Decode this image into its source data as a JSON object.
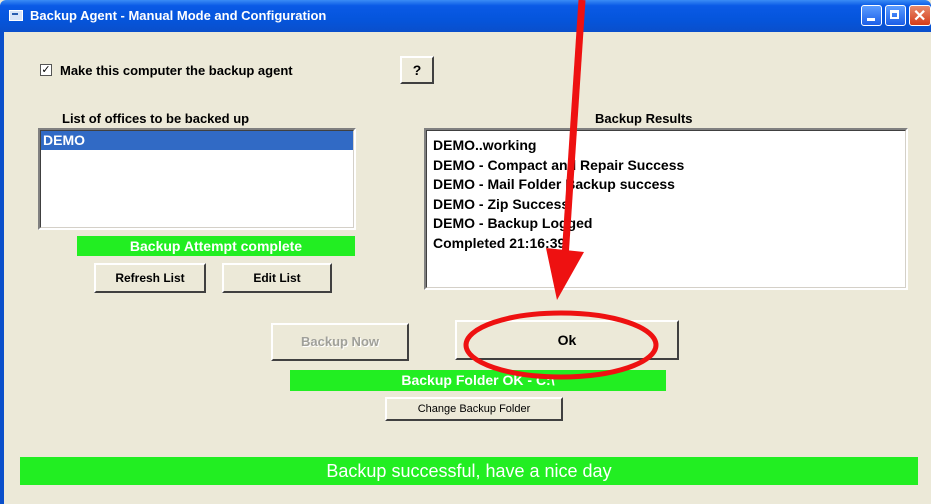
{
  "window": {
    "title": "Backup Agent - Manual Mode and Configuration"
  },
  "agent": {
    "checkbox_label": "Make this computer the backup agent",
    "checked": true,
    "check_glyph": "✓",
    "help_label": "?"
  },
  "offices": {
    "header": "List of offices to be backed up",
    "items": [
      "DEMO"
    ],
    "selected_index": 0,
    "status": "Backup Attempt complete",
    "refresh_label": "Refresh List",
    "edit_label": "Edit List"
  },
  "results": {
    "header": "Backup Results",
    "lines": [
      "DEMO..working",
      "DEMO - Compact and Repair Success",
      "DEMO - Mail Folder Backup success",
      "DEMO - Zip Success",
      "DEMO - Backup Logged",
      "Completed 21:16:39"
    ]
  },
  "actions": {
    "backup_now_label": "Backup Now",
    "ok_label": "Ok"
  },
  "folder": {
    "status": "Backup Folder OK - C:\\",
    "change_label": "Change Backup Folder"
  },
  "footer": {
    "message": "Backup successful, have a nice day"
  },
  "colors": {
    "status_green": "#22ee22",
    "annotation_red": "#ee1111",
    "selection_blue": "#316ac5",
    "title_blue": "#0555dc"
  }
}
